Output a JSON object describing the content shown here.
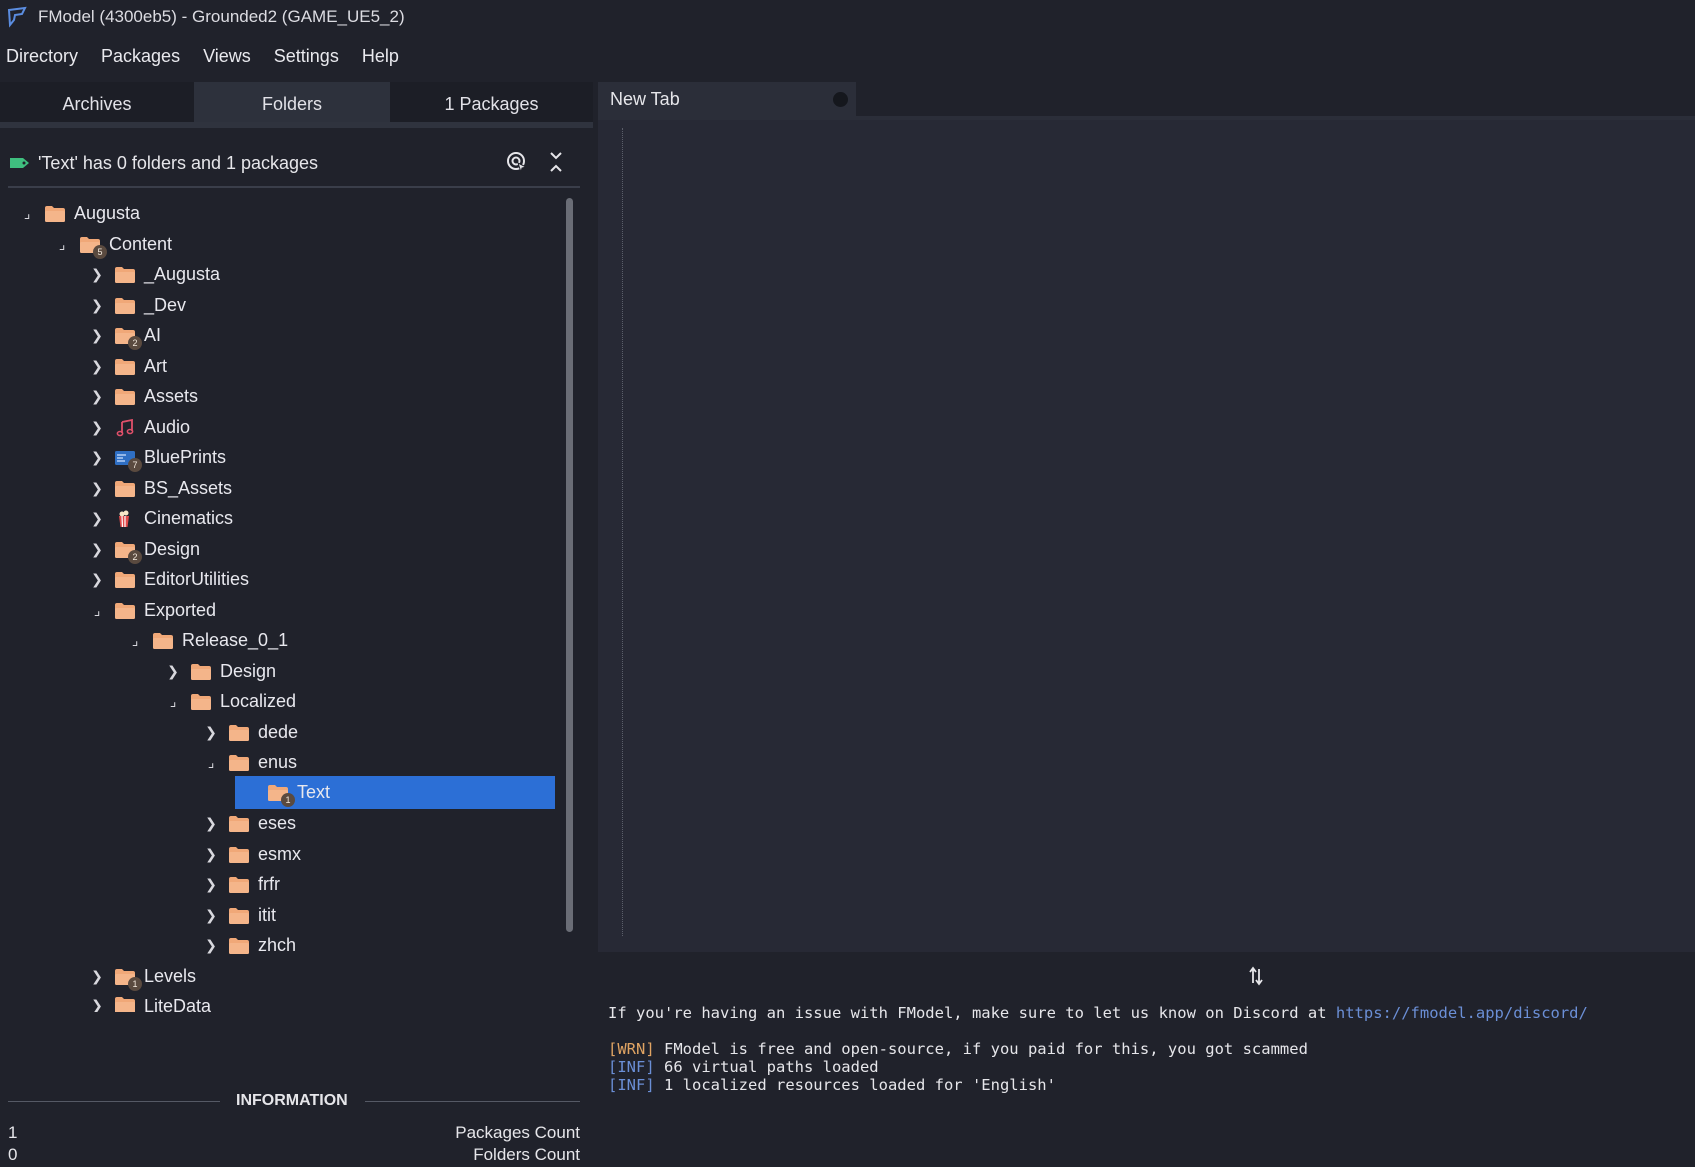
{
  "window": {
    "title": "FModel (4300eb5) - Grounded2 (GAME_UE5_2)"
  },
  "menu": [
    "Directory",
    "Packages",
    "Views",
    "Settings",
    "Help"
  ],
  "left_tabs": [
    "Archives",
    "Folders",
    "1 Packages"
  ],
  "folder_header": "'Text' has 0 folders and 1 packages",
  "tree": [
    {
      "label": "Augusta",
      "icon": "folder-icon",
      "expanded": true
    },
    {
      "label": "Content",
      "icon": "folder-icon",
      "badge": "5",
      "expanded": true
    },
    {
      "label": "_Augusta",
      "icon": "folder-icon"
    },
    {
      "label": "_Dev",
      "icon": "folder-icon"
    },
    {
      "label": "AI",
      "icon": "folder-icon",
      "badge": "2"
    },
    {
      "label": "Art",
      "icon": "folder-icon"
    },
    {
      "label": "Assets",
      "icon": "folder-icon"
    },
    {
      "label": "Audio",
      "icon": "music-note-icon"
    },
    {
      "label": "BluePrints",
      "icon": "blueprint-icon",
      "badge": "7"
    },
    {
      "label": "BS_Assets",
      "icon": "folder-icon"
    },
    {
      "label": "Cinematics",
      "icon": "popcorn-icon"
    },
    {
      "label": "Design",
      "icon": "folder-icon",
      "badge": "2"
    },
    {
      "label": "EditorUtilities",
      "icon": "folder-icon"
    },
    {
      "label": "Exported",
      "icon": "folder-icon",
      "expanded": true
    },
    {
      "label": "Release_0_1",
      "icon": "folder-icon",
      "expanded": true
    },
    {
      "label": "Design",
      "icon": "folder-icon"
    },
    {
      "label": "Localized",
      "icon": "folder-icon",
      "expanded": true
    },
    {
      "label": "dede",
      "icon": "folder-icon"
    },
    {
      "label": "enus",
      "icon": "folder-icon",
      "expanded": true
    },
    {
      "label": "Text",
      "icon": "folder-icon",
      "badge": "1",
      "selected": true
    },
    {
      "label": "eses",
      "icon": "folder-icon"
    },
    {
      "label": "esmx",
      "icon": "folder-icon"
    },
    {
      "label": "frfr",
      "icon": "folder-icon"
    },
    {
      "label": "itit",
      "icon": "folder-icon"
    },
    {
      "label": "zhch",
      "icon": "folder-icon"
    },
    {
      "label": "Levels",
      "icon": "folder-icon",
      "badge": "1"
    },
    {
      "label": "LiteData",
      "icon": "folder-icon"
    }
  ],
  "information": {
    "title": "INFORMATION",
    "rows": [
      {
        "value": "1",
        "label": "Packages Count"
      },
      {
        "value": "0",
        "label": "Folders Count"
      }
    ]
  },
  "doc_tab": {
    "label": "New Tab"
  },
  "console": {
    "intro": "If you're having an issue with FModel, make sure to let us know on Discord at ",
    "link": "https://fmodel.app/discord/",
    "logs": [
      {
        "level": "[WRN]",
        "text": " FModel is free and open-source, if you paid for this, you got scammed"
      },
      {
        "level": "[INF]",
        "text": " 66 virtual paths loaded"
      },
      {
        "level": "[INF]",
        "text": " 1 localized resources loaded for 'English'"
      }
    ]
  },
  "colors": {
    "background": "#20222b",
    "editor": "#272935",
    "selection": "#2c6fd6",
    "folder": "#f0a878",
    "warn": "#e0a463",
    "info": "#6b8fd6"
  }
}
